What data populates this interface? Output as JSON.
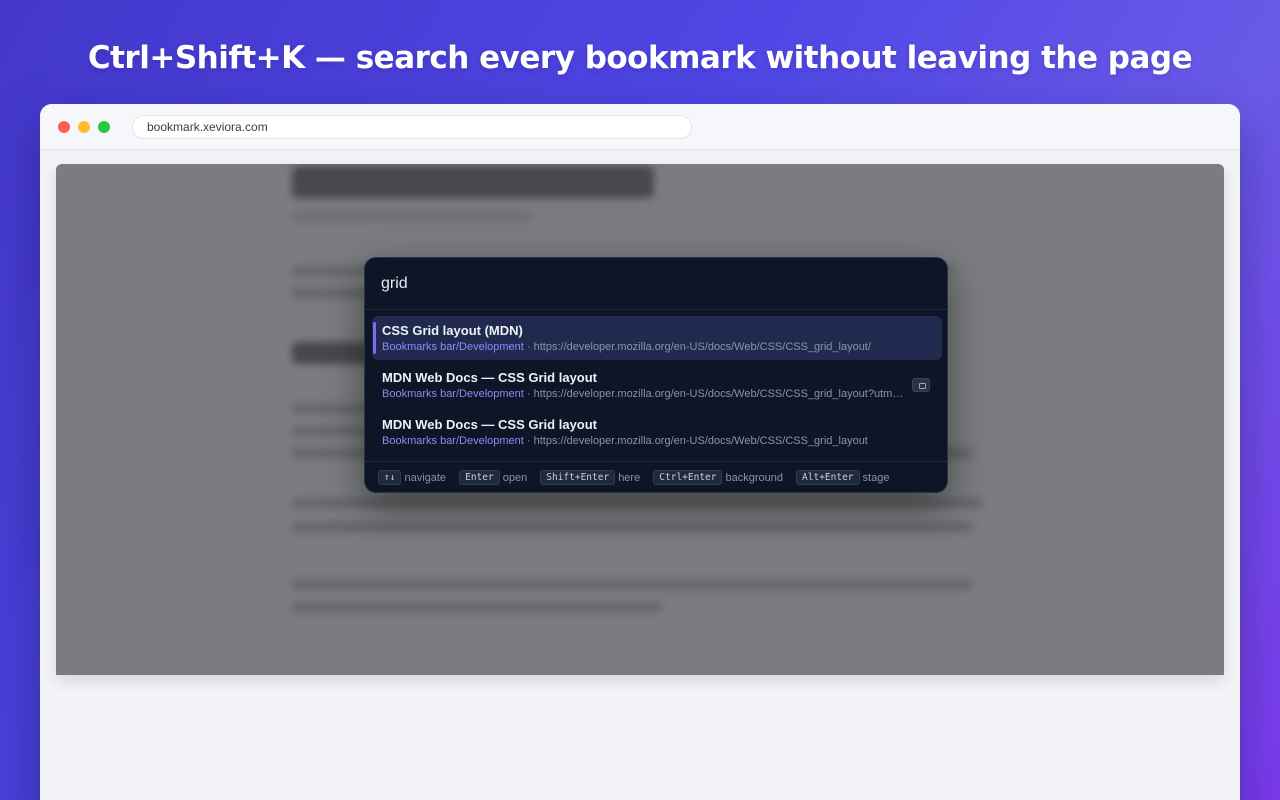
{
  "headline": "Ctrl+Shift+K — search every bookmark without leaving the page",
  "browser": {
    "url": "bookmark.xeviora.com"
  },
  "palette": {
    "query": "grid",
    "results": [
      {
        "title": "CSS Grid layout (MDN)",
        "folder": "Bookmarks bar/Development",
        "separator": " · ",
        "url": "https://developer.mozilla.org/en-US/docs/Web/CSS/CSS_grid_layout/",
        "active": true
      },
      {
        "title": "MDN Web Docs — CSS Grid layout",
        "folder": "Bookmarks bar/Development",
        "separator": " · ",
        "url": "https://developer.mozilla.org/en-US/docs/Web/CSS/CSS_grid_layout?utm_sourc...",
        "active": false,
        "badge_icon": "open-tab-icon"
      },
      {
        "title": "MDN Web Docs — CSS Grid layout",
        "folder": "Bookmarks bar/Development",
        "separator": " · ",
        "url": "https://developer.mozilla.org/en-US/docs/Web/CSS/CSS_grid_layout",
        "active": false
      }
    ],
    "hints": [
      {
        "key": "↑↓",
        "label": "navigate"
      },
      {
        "key": "Enter",
        "label": "open"
      },
      {
        "key": "Shift+Enter",
        "label": "here"
      },
      {
        "key": "Ctrl+Enter",
        "label": "background"
      },
      {
        "key": "Alt+Enter",
        "label": "stage"
      }
    ]
  },
  "colors": {
    "accent": "#7c6cf0",
    "folder": "#8b8cf8",
    "palette_bg": "#0e1526",
    "active_row": "#202a4e"
  }
}
